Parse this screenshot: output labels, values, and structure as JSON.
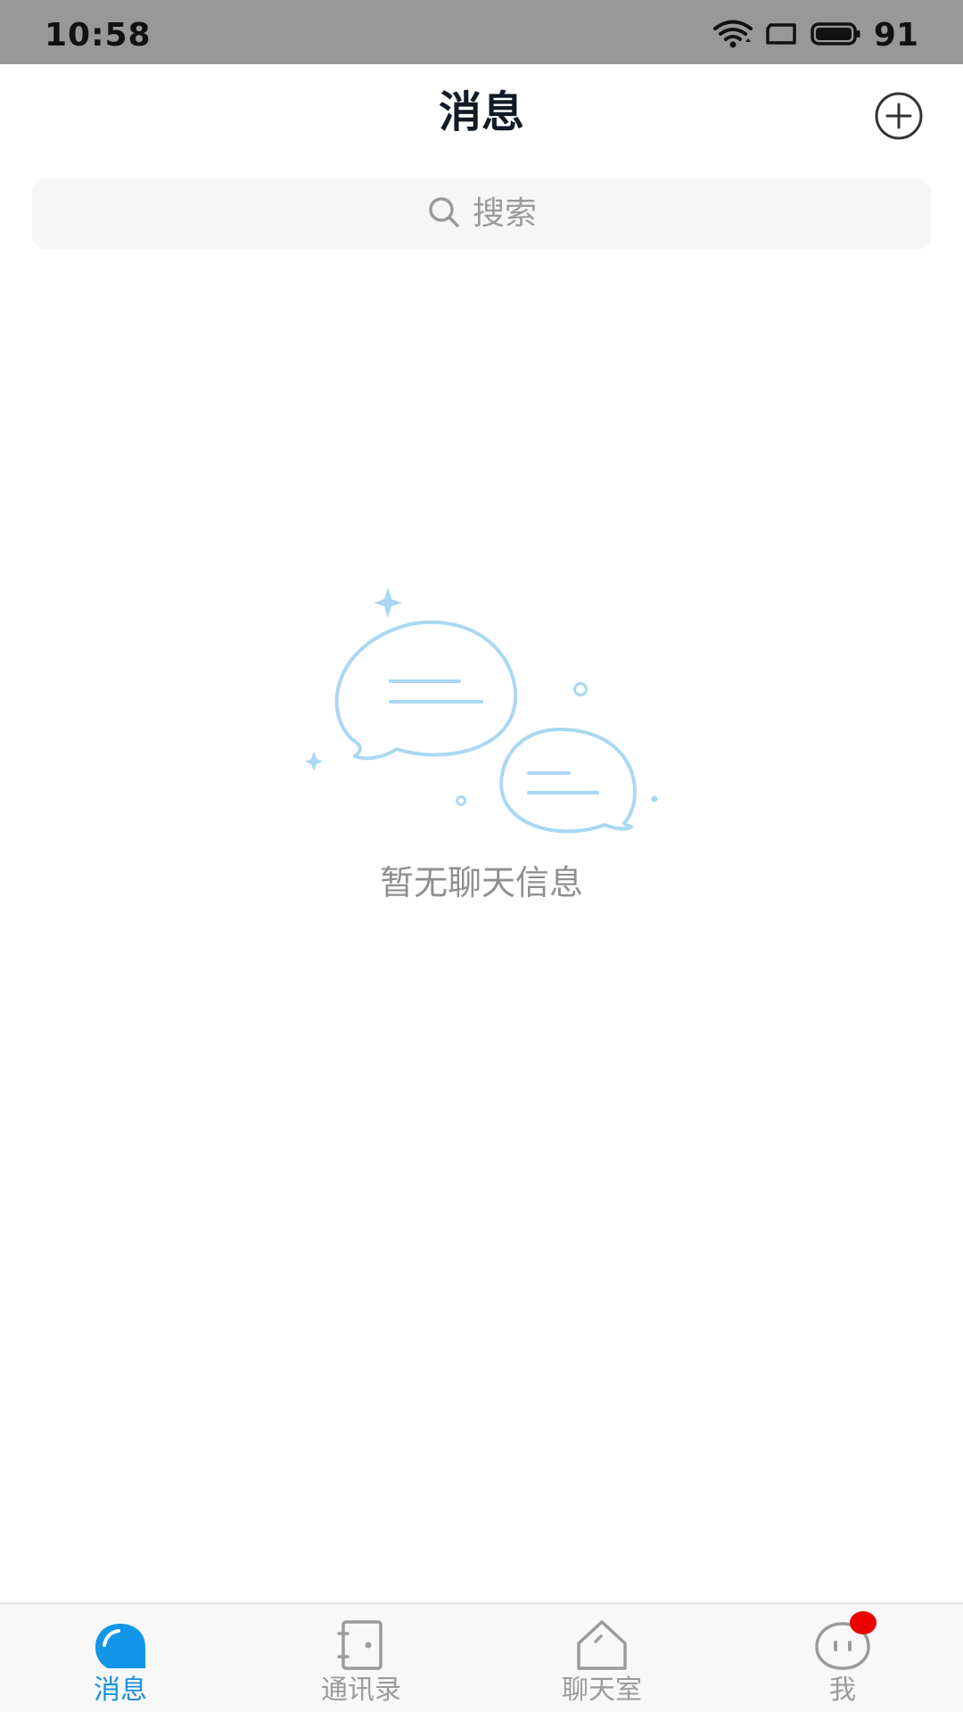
{
  "status_bar": {
    "time": "10:58",
    "battery": "91",
    "icons": [
      "wifi-icon",
      "screen-rotate-icon",
      "battery-icon"
    ]
  },
  "header": {
    "title": "消息",
    "add_icon": "plus-circle-icon"
  },
  "search": {
    "placeholder": "搜索",
    "icon": "search-icon"
  },
  "empty_state": {
    "icon": "chat-bubbles-illustration",
    "message": "暂无聊天信息"
  },
  "bottom_nav": {
    "items": [
      {
        "label": "消息",
        "icon": "message-bubble-icon",
        "active": true
      },
      {
        "label": "通讯录",
        "icon": "contacts-book-icon",
        "active": false
      },
      {
        "label": "聊天室",
        "icon": "chat-room-house-icon",
        "active": false
      },
      {
        "label": "我",
        "icon": "profile-face-icon",
        "active": false,
        "badge": true
      }
    ]
  },
  "colors": {
    "accent": "#1b8fdb",
    "status_bar": "#989898",
    "badge": "#ee0000",
    "illustration": "#a9d8f2"
  }
}
